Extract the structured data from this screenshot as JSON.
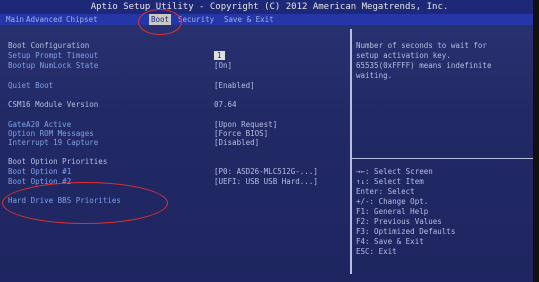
{
  "title": "Aptio Setup Utility - Copyright (C) 2012 American Megatrends, Inc.",
  "tabs": [
    {
      "label": "Main",
      "active": false
    },
    {
      "label": "Advanced",
      "active": false
    },
    {
      "label": "Chipset",
      "active": false
    },
    {
      "label": "Boot",
      "active": true
    },
    {
      "label": "Security",
      "active": false
    },
    {
      "label": "Save & Exit",
      "active": false
    }
  ],
  "settings": {
    "section_title": "Boot Configuration",
    "setup_prompt_timeout": {
      "label": "Setup Prompt Timeout",
      "value": "1"
    },
    "bootup_numlock": {
      "label": "Bootup NumLock State",
      "value": "[On]"
    },
    "quiet_boot": {
      "label": "Quiet Boot",
      "value": "[Enabled]"
    },
    "csm16": {
      "label": "CSM16 Module Version",
      "value": "07.64"
    },
    "gatea20": {
      "label": "GateA20 Active",
      "value": "[Upon Request]"
    },
    "option_rom": {
      "label": "Option ROM Messages",
      "value": "[Force BIOS]"
    },
    "int19": {
      "label": "Interrupt 19 Capture",
      "value": "[Disabled]"
    },
    "priorities_title": "Boot Option Priorities",
    "boot1": {
      "label": "Boot Option #1",
      "value": "[P0: ASD26-MLC512G-...]"
    },
    "boot2": {
      "label": "Boot Option #2",
      "value": "[UEFI: USB USB Hard...]"
    },
    "hdd_bbs": {
      "label": "Hard Drive BBS Priorities"
    }
  },
  "help_text": "Number of seconds to wait for\nsetup activation key.\n65535(0xFFFF) means indefinite\nwaiting.",
  "keys": [
    "→←: Select Screen",
    "↑↓: Select Item",
    "Enter: Select",
    "+/-: Change Opt.",
    "F1: General Help",
    "F2: Previous Values",
    "F3: Optimized Defaults",
    "F4: Save & Exit",
    "ESC: Exit"
  ],
  "colors": {
    "background": "#222a66",
    "highlight": "#dedede",
    "annotation": "#e23030"
  }
}
